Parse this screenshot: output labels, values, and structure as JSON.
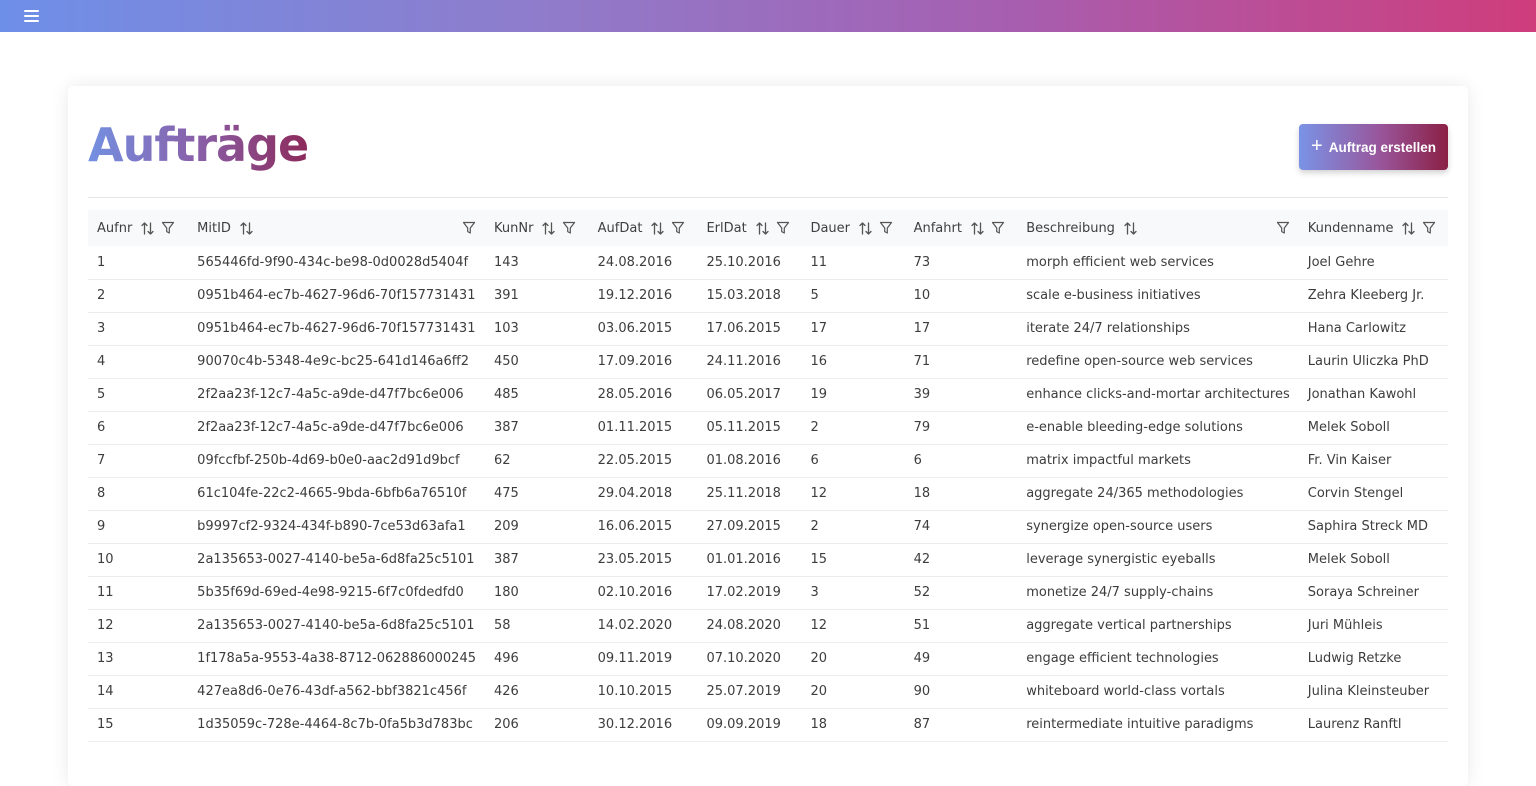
{
  "header": {
    "menu_icon": "hamburger-menu-icon"
  },
  "page": {
    "title": "Aufträge",
    "create_button_label": "Auftrag erstellen"
  },
  "table": {
    "columns": [
      {
        "key": "aufnr",
        "label": "Aufnr",
        "sortable": true,
        "filterable": true,
        "filter_right": false
      },
      {
        "key": "mitid",
        "label": "MitID",
        "sortable": true,
        "filterable": true,
        "filter_right": true
      },
      {
        "key": "kunnr",
        "label": "KunNr",
        "sortable": true,
        "filterable": true,
        "filter_right": false
      },
      {
        "key": "aufdat",
        "label": "AufDat",
        "sortable": true,
        "filterable": true,
        "filter_right": false
      },
      {
        "key": "erldat",
        "label": "ErlDat",
        "sortable": true,
        "filterable": true,
        "filter_right": false
      },
      {
        "key": "dauer",
        "label": "Dauer",
        "sortable": true,
        "filterable": true,
        "filter_right": false
      },
      {
        "key": "anfahrt",
        "label": "Anfahrt",
        "sortable": true,
        "filterable": true,
        "filter_right": false
      },
      {
        "key": "beschreibung",
        "label": "Beschreibung",
        "sortable": true,
        "filterable": true,
        "filter_right": true
      },
      {
        "key": "kundenname",
        "label": "Kundenname",
        "sortable": true,
        "filterable": true,
        "filter_right": false
      }
    ],
    "rows": [
      [
        "1",
        "565446fd-9f90-434c-be98-0d0028d5404f",
        "143",
        "24.08.2016",
        "25.10.2016",
        "11",
        "73",
        "morph efficient web services",
        "Joel Gehre"
      ],
      [
        "2",
        "0951b464-ec7b-4627-96d6-70f157731431",
        "391",
        "19.12.2016",
        "15.03.2018",
        "5",
        "10",
        "scale e-business initiatives",
        "Zehra Kleeberg Jr."
      ],
      [
        "3",
        "0951b464-ec7b-4627-96d6-70f157731431",
        "103",
        "03.06.2015",
        "17.06.2015",
        "17",
        "17",
        "iterate 24/7 relationships",
        "Hana Carlowitz"
      ],
      [
        "4",
        "90070c4b-5348-4e9c-bc25-641d146a6ff2",
        "450",
        "17.09.2016",
        "24.11.2016",
        "16",
        "71",
        "redefine open-source web services",
        "Laurin Uliczka PhD"
      ],
      [
        "5",
        "2f2aa23f-12c7-4a5c-a9de-d47f7bc6e006",
        "485",
        "28.05.2016",
        "06.05.2017",
        "19",
        "39",
        "enhance clicks-and-mortar architectures",
        "Jonathan Kawohl"
      ],
      [
        "6",
        "2f2aa23f-12c7-4a5c-a9de-d47f7bc6e006",
        "387",
        "01.11.2015",
        "05.11.2015",
        "2",
        "79",
        "e-enable bleeding-edge solutions",
        "Melek Soboll"
      ],
      [
        "7",
        "09fccfbf-250b-4d69-b0e0-aac2d91d9bcf",
        "62",
        "22.05.2015",
        "01.08.2016",
        "6",
        "6",
        "matrix impactful markets",
        "Fr. Vin Kaiser"
      ],
      [
        "8",
        "61c104fe-22c2-4665-9bda-6bfb6a76510f",
        "475",
        "29.04.2018",
        "25.11.2018",
        "12",
        "18",
        "aggregate 24/365 methodologies",
        "Corvin Stengel"
      ],
      [
        "9",
        "b9997cf2-9324-434f-b890-7ce53d63afa1",
        "209",
        "16.06.2015",
        "27.09.2015",
        "2",
        "74",
        "synergize open-source users",
        "Saphira Streck MD"
      ],
      [
        "10",
        "2a135653-0027-4140-be5a-6d8fa25c5101",
        "387",
        "23.05.2015",
        "01.01.2016",
        "15",
        "42",
        "leverage synergistic eyeballs",
        "Melek Soboll"
      ],
      [
        "11",
        "5b35f69d-69ed-4e98-9215-6f7c0fdedfd0",
        "180",
        "02.10.2016",
        "17.02.2019",
        "3",
        "52",
        "monetize 24/7 supply-chains",
        "Soraya Schreiner"
      ],
      [
        "12",
        "2a135653-0027-4140-be5a-6d8fa25c5101",
        "58",
        "14.02.2020",
        "24.08.2020",
        "12",
        "51",
        "aggregate vertical partnerships",
        "Juri Mühleis"
      ],
      [
        "13",
        "1f178a5a-9553-4a38-8712-062886000245",
        "496",
        "09.11.2019",
        "07.10.2020",
        "20",
        "49",
        "engage efficient technologies",
        "Ludwig Retzke"
      ],
      [
        "14",
        "427ea8d6-0e76-43df-a562-bbf3821c456f",
        "426",
        "10.10.2015",
        "25.07.2019",
        "20",
        "90",
        "whiteboard world-class vortals",
        "Julina Kleinsteuber"
      ],
      [
        "15",
        "1d35059c-728e-4464-8c7b-0fa5b3d783bc",
        "206",
        "30.12.2016",
        "09.09.2019",
        "18",
        "87",
        "reintermediate intuitive paradigms",
        "Laurenz Ranftl"
      ]
    ]
  }
}
